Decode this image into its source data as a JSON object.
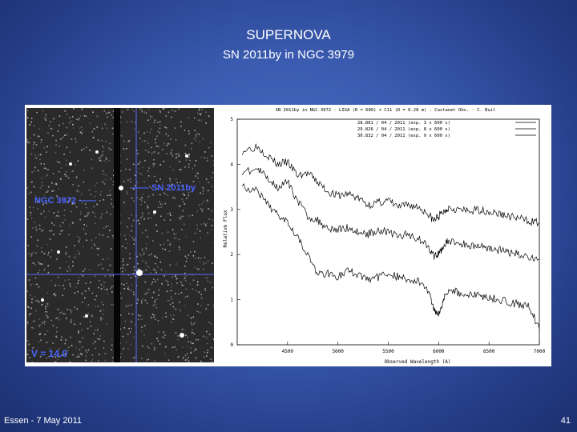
{
  "slide": {
    "title": "SUPERNOVA",
    "subtitle": "SN 2011by in NGC 3979",
    "footer_left": "Essen - 7 May 2011",
    "page_number": "41"
  },
  "image": {
    "sn_label": "—— SN 2011by",
    "galaxy_label": "NGC 3972 ——",
    "magnitude_label": "V = 14.0"
  },
  "chart_data": {
    "type": "line",
    "title": "SN 2011by in NGC 3972 - LIGA (R = 600) + C11 (D = 0.28 m) - Castanet Obs. - C. Buil",
    "xlabel": "Observed Wavelength (A)",
    "ylabel": "Relative Flux",
    "xlim": [
      4000,
      7000
    ],
    "ylim": [
      0,
      5
    ],
    "x_ticks": [
      "4500",
      "5000",
      "5500",
      "6000",
      "6500",
      "7000"
    ],
    "y_ticks": [
      "0",
      "1",
      "2",
      "3",
      "4",
      "5"
    ],
    "legend_position": "top-right",
    "series": [
      {
        "name": "28.881 / 04 / 2011 (exp. 3 x 600 s)",
        "color": "#000000",
        "x": [
          4050,
          4200,
          4300,
          4400,
          4500,
          4600,
          4700,
          4800,
          4900,
          5000,
          5100,
          5200,
          5300,
          5400,
          5500,
          5600,
          5700,
          5800,
          5900,
          5950,
          6000,
          6050,
          6100,
          6200,
          6300,
          6400,
          6500,
          6600,
          6700,
          6800,
          6900,
          7000
        ],
        "y": [
          4.3,
          4.4,
          4.2,
          4.0,
          4.05,
          3.75,
          3.8,
          3.6,
          3.4,
          3.3,
          3.35,
          3.25,
          3.1,
          3.15,
          3.2,
          3.05,
          3.1,
          3.05,
          2.9,
          2.75,
          2.85,
          2.95,
          3.05,
          3.0,
          2.95,
          3.0,
          2.95,
          2.9,
          2.85,
          2.8,
          2.75,
          2.7
        ]
      },
      {
        "name": "29.826 / 04 / 2011 (exp. 8 x 600 s)",
        "color": "#000000",
        "x": [
          4050,
          4200,
          4300,
          4400,
          4500,
          4600,
          4700,
          4800,
          4900,
          5000,
          5100,
          5200,
          5300,
          5400,
          5500,
          5600,
          5700,
          5800,
          5900,
          5950,
          6000,
          6050,
          6100,
          6200,
          6300,
          6400,
          6500,
          6600,
          6700,
          6800,
          6900,
          7000
        ],
        "y": [
          3.8,
          3.9,
          3.7,
          3.5,
          3.6,
          3.2,
          2.85,
          2.75,
          2.6,
          2.55,
          2.6,
          2.5,
          2.45,
          2.55,
          2.5,
          2.4,
          2.45,
          2.35,
          2.2,
          1.95,
          2.0,
          2.2,
          2.3,
          2.25,
          2.2,
          2.2,
          2.15,
          2.1,
          2.05,
          2.0,
          1.95,
          1.9
        ]
      },
      {
        "name": "30.832 / 04 / 2011 (exp. 9 x 600 s)",
        "color": "#000000",
        "x": [
          4050,
          4200,
          4300,
          4400,
          4500,
          4600,
          4700,
          4800,
          4900,
          5000,
          5100,
          5200,
          5300,
          5400,
          5500,
          5600,
          5700,
          5800,
          5900,
          5950,
          6000,
          6050,
          6100,
          6200,
          6300,
          6400,
          6500,
          6600,
          6700,
          6800,
          6900,
          7000
        ],
        "y": [
          3.5,
          3.4,
          3.1,
          2.9,
          2.75,
          2.4,
          2.0,
          1.55,
          1.6,
          1.5,
          1.65,
          1.55,
          1.45,
          1.5,
          1.6,
          1.5,
          1.45,
          1.4,
          1.2,
          0.8,
          0.7,
          1.0,
          1.25,
          1.15,
          1.1,
          1.1,
          1.05,
          1.0,
          0.95,
          0.9,
          0.85,
          0.35
        ]
      }
    ]
  }
}
